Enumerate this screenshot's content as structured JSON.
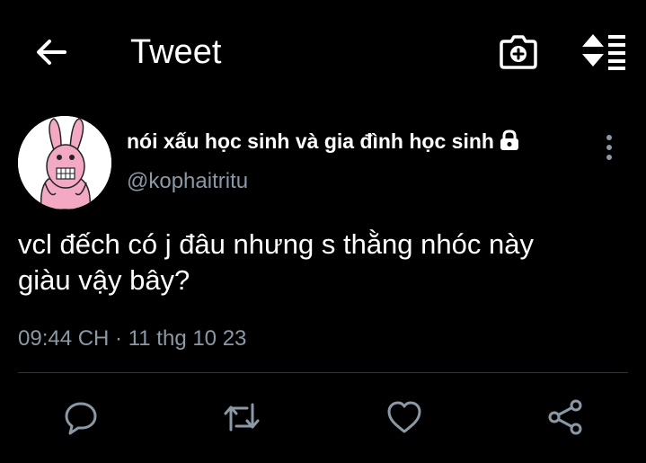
{
  "header": {
    "title": "Tweet",
    "back_icon": "arrow-left-icon",
    "camera_icon": "camera-plus-icon",
    "sort_icon": "sort-list-icon"
  },
  "tweet": {
    "author": {
      "display_name": "nói xấu học sinh và gia đình học sinh",
      "handle": "@kophaitritu",
      "protected": true,
      "avatar_icon": "pink-bunny-avatar"
    },
    "text_line1": "vcl đếch có j đâu nhưng s thằng nhóc này",
    "text_line2": "giàu vậy bây?",
    "meta": "09:44 CH · 11 thg 10 23",
    "actions": [
      "reply-icon",
      "retweet-icon",
      "like-icon",
      "share-icon"
    ]
  },
  "colors": {
    "background": "#000000",
    "text_primary": "#ffffff",
    "text_secondary": "#8b98a5",
    "divider": "#2f3336",
    "icon": "#8b98a5"
  }
}
